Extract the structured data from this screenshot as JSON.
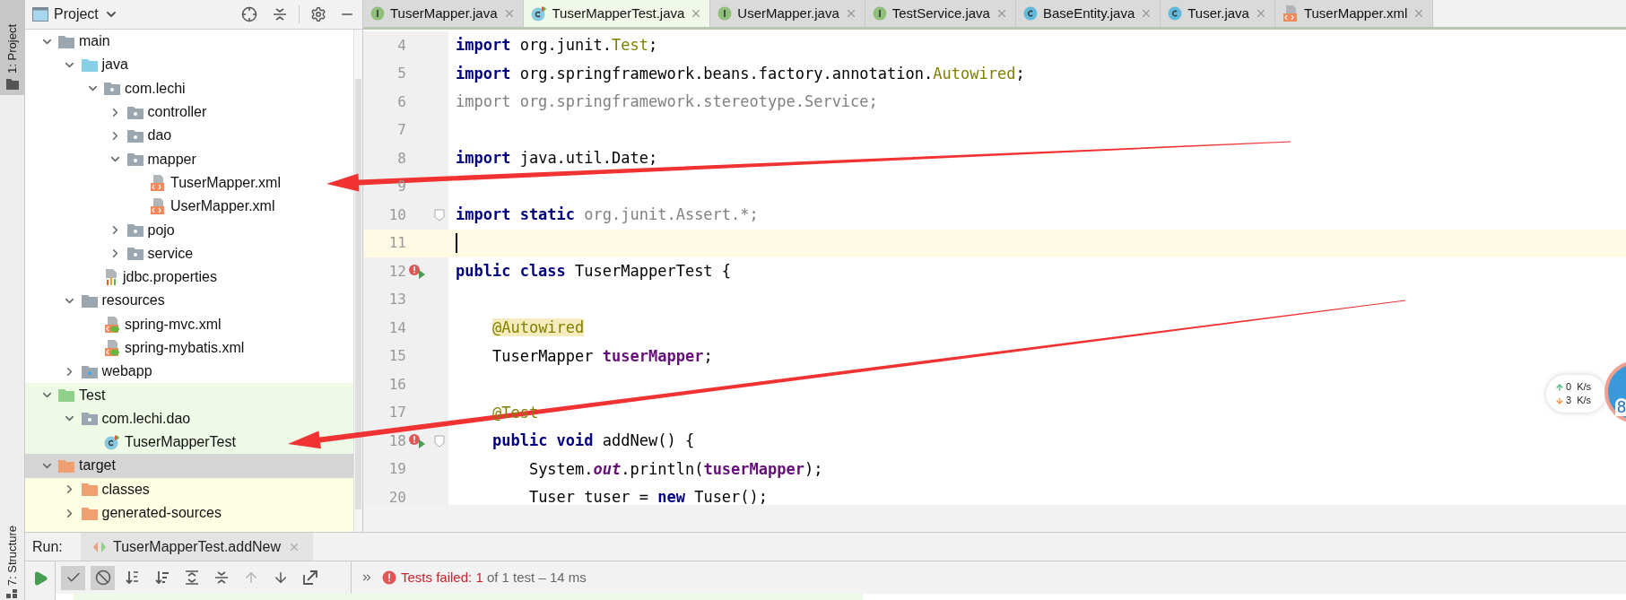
{
  "sidebar_stripe": {
    "top_label": "1: Project",
    "bottom_label": "7: Structure"
  },
  "project_panel": {
    "title": "Project",
    "tree": [
      {
        "children": [
          {
            "label": "main",
            "kind": "folder",
            "expanded": true,
            "selected": false,
            "children": [
              {
                "label": "java",
                "kind": "source-root",
                "expanded": true,
                "selected": false,
                "children": [
                  {
                    "label": "com.lechi",
                    "kind": "package",
                    "expanded": true,
                    "selected": false,
                    "children": [
                      {
                        "label": "controller",
                        "kind": "package",
                        "expanded": false,
                        "selected": false
                      },
                      {
                        "label": "dao",
                        "kind": "package",
                        "expanded": false,
                        "selected": false
                      },
                      {
                        "label": "mapper",
                        "kind": "package",
                        "expanded": true,
                        "selected": false,
                        "children": [
                          {
                            "label": "TuserMapper.xml",
                            "kind": "xml",
                            "selected": false
                          },
                          {
                            "label": "UserMapper.xml",
                            "kind": "xml",
                            "selected": false
                          }
                        ]
                      },
                      {
                        "label": "pojo",
                        "kind": "package",
                        "expanded": false,
                        "selected": false
                      },
                      {
                        "label": "service",
                        "kind": "package",
                        "expanded": false,
                        "selected": false
                      }
                    ]
                  },
                  {
                    "label": "jdbc.properties",
                    "kind": "properties",
                    "selected": false
                  }
                ]
              },
              {
                "label": "resources",
                "kind": "resource-root",
                "expanded": true,
                "selected": false,
                "children": [
                  {
                    "label": "spring-mvc.xml",
                    "kind": "spring-xml",
                    "selected": false
                  },
                  {
                    "label": "spring-mybatis.xml",
                    "kind": "spring-xml",
                    "selected": false
                  }
                ]
              },
              {
                "label": "webapp",
                "kind": "web",
                "expanded": false,
                "selected": false
              }
            ]
          },
          {
            "label": "Test",
            "kind": "test-root",
            "expanded": true,
            "selected": false,
            "children": [
              {
                "label": "com.lechi.dao",
                "kind": "package",
                "expanded": true,
                "selected": false,
                "children": [
                  {
                    "label": "TuserMapperTest",
                    "kind": "test-class",
                    "selected": false
                  }
                ]
              }
            ]
          }
        ]
      },
      {
        "label": "target",
        "kind": "excluded",
        "expanded": true,
        "selected": true,
        "children": [
          {
            "label": "classes",
            "kind": "excluded",
            "expanded": false,
            "selected": false
          },
          {
            "label": "generated-sources",
            "kind": "excluded",
            "expanded": false,
            "selected": false
          }
        ]
      }
    ]
  },
  "editor": {
    "tabs": [
      {
        "label": "TuserMapper.java",
        "kind": "interface",
        "selected": false
      },
      {
        "label": "TuserMapperTest.java",
        "kind": "test-class",
        "selected": true
      },
      {
        "label": "UserMapper.java",
        "kind": "interface",
        "selected": false
      },
      {
        "label": "TestService.java",
        "kind": "interface",
        "selected": false
      },
      {
        "label": "BaseEntity.java",
        "kind": "class",
        "selected": false
      },
      {
        "label": "Tuser.java",
        "kind": "class",
        "selected": false
      },
      {
        "label": "TuserMapper.xml",
        "kind": "xml",
        "selected": false
      }
    ],
    "lines": [
      {
        "number": "4",
        "current": false,
        "run_marker": false,
        "fold": false,
        "tokens": [
          {
            "kind": "keyword",
            "text": "import"
          },
          {
            "kind": "plain",
            "text": " org.junit."
          },
          {
            "kind": "annotation",
            "text": "Test"
          },
          {
            "kind": "plain",
            "text": ";"
          }
        ]
      },
      {
        "number": "5",
        "current": false,
        "run_marker": false,
        "fold": false,
        "tokens": [
          {
            "kind": "keyword",
            "text": "import"
          },
          {
            "kind": "plain",
            "text": " org.springframework.beans.factory.annotation."
          },
          {
            "kind": "annotation",
            "text": "Autowired"
          },
          {
            "kind": "plain",
            "text": ";"
          }
        ]
      },
      {
        "number": "6",
        "current": false,
        "run_marker": false,
        "fold": false,
        "tokens": [
          {
            "kind": "unused",
            "text": "import org.springframework.stereotype.Service;"
          }
        ]
      },
      {
        "number": "7",
        "current": false,
        "run_marker": false,
        "fold": false
      },
      {
        "number": "8",
        "current": false,
        "run_marker": false,
        "fold": false,
        "tokens": [
          {
            "kind": "keyword",
            "text": "import"
          },
          {
            "kind": "plain",
            "text": " java.util.Date;"
          }
        ]
      },
      {
        "number": "9",
        "current": false,
        "run_marker": false,
        "fold": false
      },
      {
        "number": "10",
        "current": false,
        "run_marker": false,
        "fold": true,
        "tokens": [
          {
            "kind": "keyword",
            "text": "import static"
          },
          {
            "kind": "unused",
            "text": " org.junit.Assert.*;"
          }
        ]
      },
      {
        "number": "11",
        "current": true,
        "run_marker": false,
        "fold": false
      },
      {
        "number": "12",
        "current": false,
        "run_marker": true,
        "fold": false,
        "tokens": [
          {
            "kind": "keyword",
            "text": "public class"
          },
          {
            "kind": "plain",
            "text": " TuserMapperTest {"
          }
        ]
      },
      {
        "number": "13",
        "current": false,
        "run_marker": false,
        "fold": false
      },
      {
        "number": "14",
        "current": false,
        "run_marker": false,
        "fold": false,
        "tokens": [
          {
            "kind": "annotation-highlight",
            "text": "    @Autowired"
          }
        ]
      },
      {
        "number": "15",
        "current": false,
        "run_marker": false,
        "fold": false,
        "tokens": [
          {
            "kind": "plain",
            "text": "    TuserMapper "
          },
          {
            "kind": "field",
            "text": "tuserMapper"
          },
          {
            "kind": "plain",
            "text": ";"
          }
        ]
      },
      {
        "number": "16",
        "current": false,
        "run_marker": false,
        "fold": false
      },
      {
        "number": "17",
        "current": false,
        "run_marker": false,
        "fold": false,
        "tokens": [
          {
            "kind": "annotation",
            "text": "    @Test"
          }
        ]
      },
      {
        "number": "18",
        "current": false,
        "run_marker": true,
        "fold": true,
        "tokens": [
          {
            "kind": "keyword",
            "text": "    public void"
          },
          {
            "kind": "plain",
            "text": " addNew() {"
          }
        ]
      },
      {
        "number": "19",
        "current": false,
        "run_marker": false,
        "fold": false,
        "tokens": [
          {
            "kind": "plain",
            "text": "        System."
          },
          {
            "kind": "static-field",
            "text": "out"
          },
          {
            "kind": "plain",
            "text": ".println("
          },
          {
            "kind": "field",
            "text": "tuserMapper"
          },
          {
            "kind": "plain",
            "text": ");"
          }
        ]
      },
      {
        "number": "20",
        "current": false,
        "run_marker": false,
        "fold": false,
        "tokens": [
          {
            "kind": "plain",
            "text": "        Tuser tuser = "
          },
          {
            "kind": "keyword",
            "text": "new"
          },
          {
            "kind": "plain",
            "text": " Tuser();"
          }
        ]
      }
    ]
  },
  "run_panel": {
    "label": "Run:",
    "tab": {
      "label": "TuserMapperTest.addNew"
    },
    "toolbar": [
      {
        "kind": "show-passed",
        "on": true,
        "disabled": false
      },
      {
        "kind": "show-ignored",
        "on": true,
        "disabled": false
      },
      {
        "kind": "sort-alpha",
        "on": false,
        "disabled": false
      },
      {
        "kind": "sort-duration",
        "on": false,
        "disabled": false
      },
      {
        "kind": "expand-all",
        "on": false,
        "disabled": false
      },
      {
        "kind": "collapse-all",
        "on": false,
        "disabled": false
      },
      {
        "kind": "previous",
        "on": false,
        "disabled": true
      },
      {
        "kind": "next",
        "on": false,
        "disabled": false
      },
      {
        "kind": "export",
        "on": false,
        "disabled": false
      }
    ],
    "status": {
      "failed_label": "Tests failed:",
      "failed_count": "1",
      "rest": "of 1 test – 14 ms"
    }
  },
  "net_widget": {
    "up": {
      "value": "0",
      "unit": "K/s"
    },
    "down": {
      "value": "3",
      "unit": "K/s"
    },
    "gauge": "8"
  }
}
